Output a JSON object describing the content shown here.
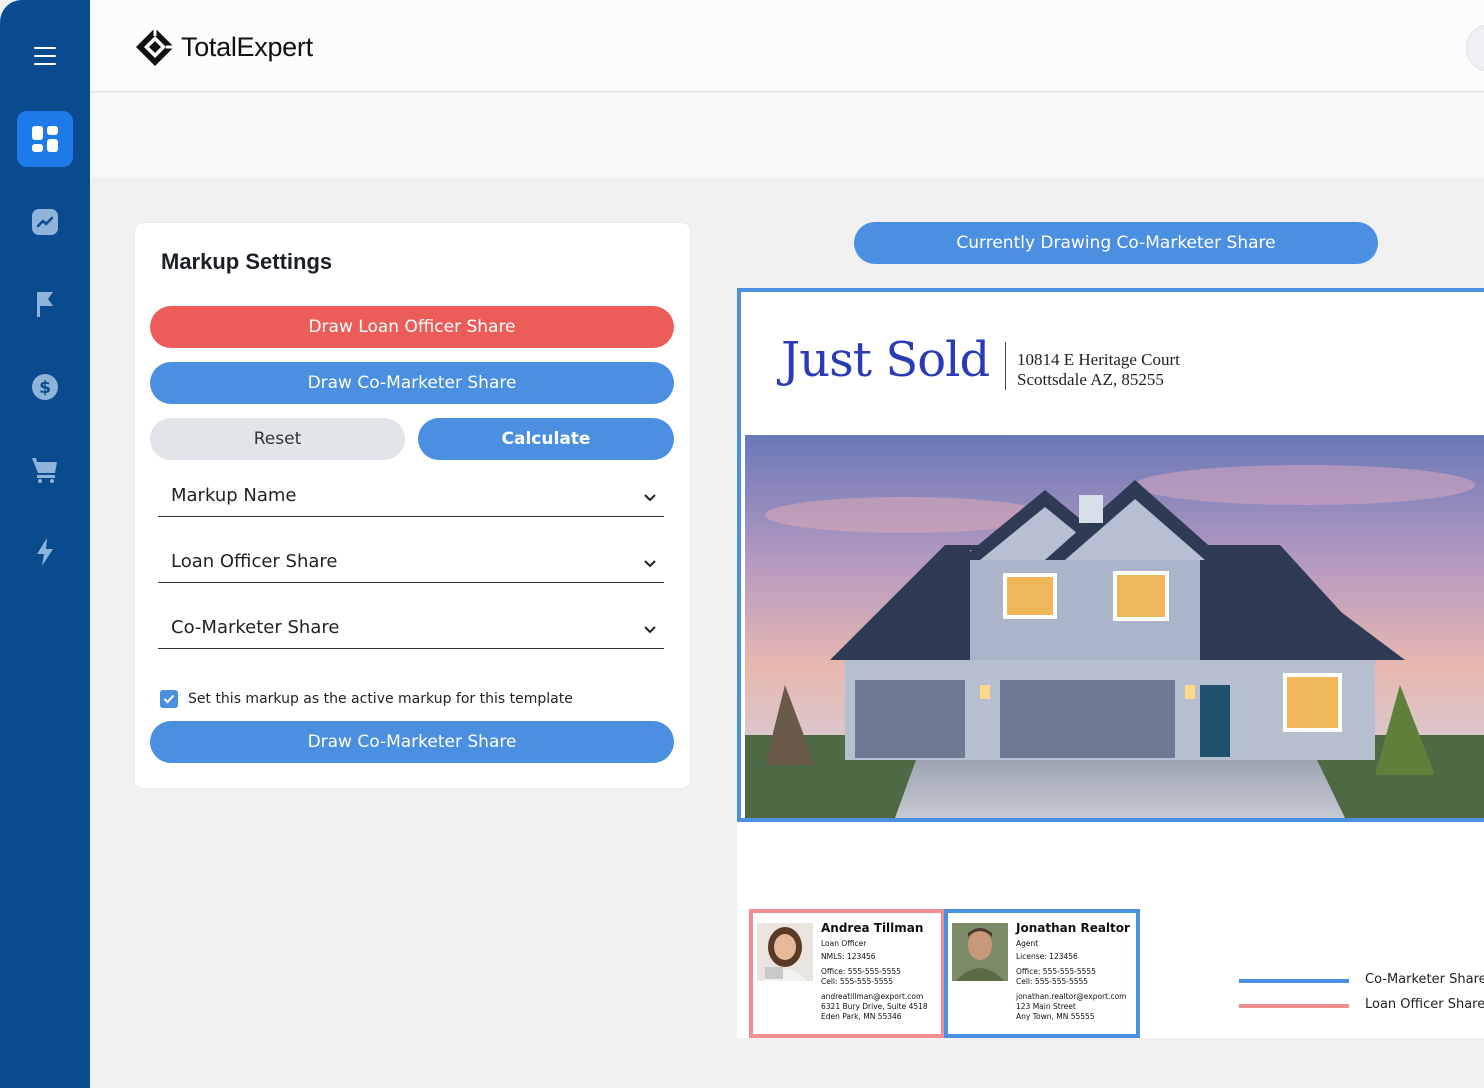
{
  "brand": {
    "name": "TotalExpert"
  },
  "colors": {
    "sidebar": "#0a4b8f",
    "accent_blue": "#4a8fe0",
    "accent_red": "#ec5d5a",
    "loan_officer_line": "#ef8f92"
  },
  "sidebar": {
    "items": [
      {
        "icon": "menu-icon"
      },
      {
        "icon": "dashboard-icon",
        "active": true
      },
      {
        "icon": "chart-icon"
      },
      {
        "icon": "flag-icon"
      },
      {
        "icon": "dollar-icon"
      },
      {
        "icon": "cart-icon"
      },
      {
        "icon": "lightning-icon"
      }
    ]
  },
  "markup_settings": {
    "title": "Markup Settings",
    "draw_loan_officer_label": "Draw Loan Officer Share",
    "draw_co_marketer_label": "Draw Co-Marketer Share",
    "reset_label": "Reset",
    "calculate_label": "Calculate",
    "fields": [
      {
        "label": "Markup Name"
      },
      {
        "label": "Loan Officer Share"
      },
      {
        "label": "Co-Marketer Share"
      }
    ],
    "active_checkbox": {
      "checked": true,
      "label": "Set this markup as the active markup for this template"
    },
    "bottom_button_label": "Draw Co-Marketer Share"
  },
  "status": {
    "label": "Currently Drawing Co-Marketer Share"
  },
  "flyer": {
    "headline": "Just Sold",
    "address_line1": "10814 E Heritage Court",
    "address_line2": "Scottsdale AZ, 85255",
    "contacts": [
      {
        "name": "Andrea Tillman",
        "role": "Loan Officer",
        "license": "NMLS: 123456",
        "office": "Office: 555-555-5555",
        "cell": "Cell: 555-555-5555",
        "email": "andreatillman@export.com",
        "street": "6321 Bury Drive, Suite 4518",
        "city": "Eden Park, MN 55346"
      },
      {
        "name": "Jonathan Realtor",
        "role": "Agent",
        "license": "License: 123456",
        "office": "Office: 555-555-5555",
        "cell": "Cell: 555-555-5555",
        "email": "jonathan.realtor@export.com",
        "street": "123 Main Street",
        "city": "Any Town, MN 55555"
      }
    ]
  },
  "legend": {
    "items": [
      {
        "label": "Co-Marketer Share",
        "color": "#4a8fe0"
      },
      {
        "label": "Loan Officer Share",
        "color": "#ef8f92"
      }
    ]
  }
}
